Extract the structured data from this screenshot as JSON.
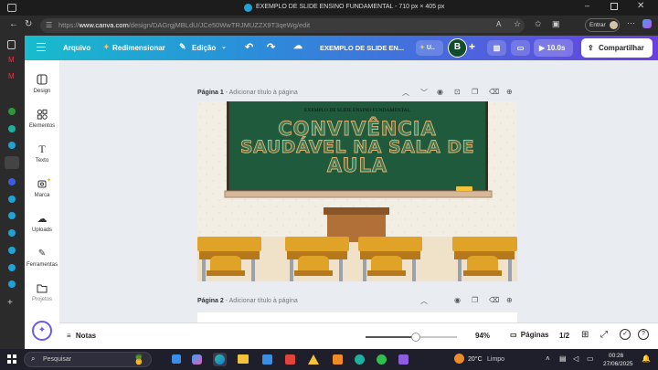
{
  "browser": {
    "tab_title": "EXEMPLO DE SLIDE ENSINO FUNDAMENTAL - 710 px × 405 px",
    "url_prefix": "https://",
    "url_domain": "www.canva.com",
    "url_path": "/design/DAGrgjMBLdU/JCe50WwTRJMUZZX9T3qeWg/edit",
    "profile_button": "Entrar"
  },
  "toolbar": {
    "file": "Arquivo",
    "resize": "Redimensionar",
    "edit": "Edição",
    "doc_title": "EXEMPLO DE SLIDE EN...",
    "upgrade": "U..",
    "avatar_letter": "B",
    "timer": "10.0s",
    "share": "Compartilhar"
  },
  "sidebar": {
    "items": [
      {
        "label": "Design",
        "icon": "design-icon"
      },
      {
        "label": "Elementos",
        "icon": "elements-icon"
      },
      {
        "label": "Texto",
        "icon": "text-icon"
      },
      {
        "label": "Marca",
        "icon": "brand-icon"
      },
      {
        "label": "Uploads",
        "icon": "upload-icon"
      },
      {
        "label": "Ferramentas",
        "icon": "tools-icon"
      },
      {
        "label": "Projetos",
        "icon": "folder-icon"
      }
    ]
  },
  "pages": [
    {
      "label": "Página 1",
      "title_placeholder": "- Adicionar título à página"
    },
    {
      "label": "Página 2",
      "title_placeholder": "- Adicionar título à página"
    }
  ],
  "slide": {
    "header_text": "EXEMPLO DE SLIDE ENSINO FUNDAMENTAL",
    "title_line1": "CONVIVÊNCIA",
    "title_line2": "SAUDÁVEL NA SALA DE",
    "title_line3": "AULA",
    "colors": {
      "board": "#1f5a3d",
      "title_fill": "#3d7a58",
      "title_stroke": "#e6b16e",
      "wall": "#f3eee4",
      "desk": "#e0a227"
    }
  },
  "bottombar": {
    "notes": "Notas",
    "zoom": "94%",
    "zoom_fraction": 0.55,
    "pages_label": "Páginas",
    "page_count": "1/2"
  },
  "taskbar": {
    "search_placeholder": "Pesquisar",
    "weather_temp": "20°C",
    "weather_desc": "Limpo",
    "time": "00:26",
    "date": "27/06/2025"
  }
}
